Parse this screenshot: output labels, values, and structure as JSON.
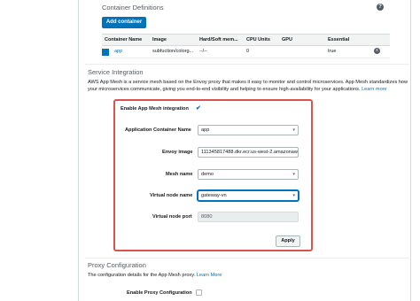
{
  "container_definitions": {
    "title": "Container Definitions",
    "help_icon": "?",
    "add_button": "Add container",
    "columns": [
      "Container Name",
      "Image",
      "Hard/Soft mem...",
      "CPU Units",
      "GPU",
      "Essential"
    ],
    "rows": [
      {
        "name": "app",
        "image": "subfuction/colorg...",
        "memory": "--/--",
        "cpu": "0",
        "gpu": "",
        "essential": "true",
        "remove_icon": "x"
      }
    ]
  },
  "service_integration": {
    "title": "Service Integration",
    "description": "AWS App Mesh is a service mesh based on the Envoy proxy that makes it easy to monitor and control microservices. App Mesh standardizes how your microservices communicate, giving you end-to-end visibility and helping to ensure high-availability for your applications.",
    "learn_more": "Learn more",
    "enable_label": "Enable App Mesh integration",
    "enable_check": "✔",
    "app_container_label": "Application Container Name",
    "app_container_value": "app",
    "envoy_label": "Envoy image",
    "envoy_value": "111345817488.dkr.ecr.us-west-2.amazonaw",
    "mesh_label": "Mesh name",
    "mesh_value": "demo",
    "vnode_label": "Virtual node name",
    "vnode_value": "gateway-vn",
    "vport_label": "Virtual node port",
    "vport_value": "8080",
    "apply_button": "Apply",
    "caret": "▾"
  },
  "proxy_configuration": {
    "title": "Proxy Configuration",
    "description": "The configuration details for the App Mesh proxy.",
    "learn_more": "Learn More",
    "enable_label": "Enable Proxy Configuration"
  },
  "colors": {
    "accent": "#0073bb",
    "highlight_border": "#d9534f"
  }
}
